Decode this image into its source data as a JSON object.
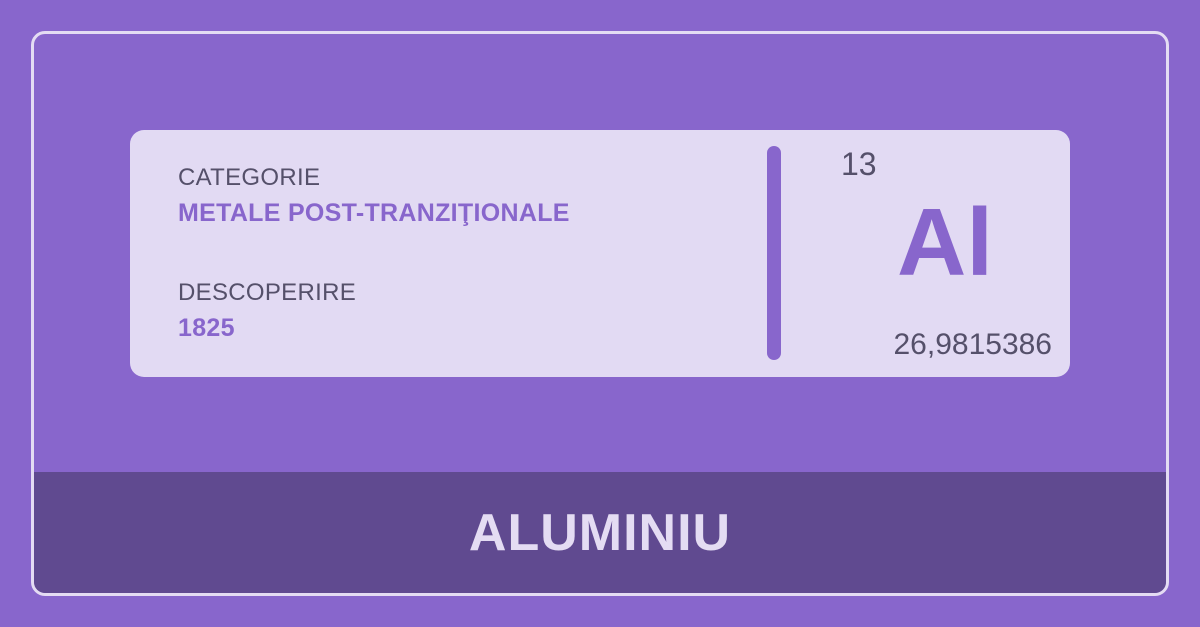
{
  "card": {
    "category_label": "CATEGORIE",
    "category_value": "METALE POST-TRANZIŢIONALE",
    "discovery_label": "DESCOPERIRE",
    "discovery_value": "1825",
    "atomic_number": "13",
    "symbol": "Al",
    "atomic_mass": "26,9815386"
  },
  "footer": {
    "element_name": "ALUMINIU"
  },
  "colors": {
    "background": "#8866cc",
    "card": "#e2daf3",
    "footer": "#604a90",
    "accent": "#8866cc",
    "text": "#55506a"
  }
}
